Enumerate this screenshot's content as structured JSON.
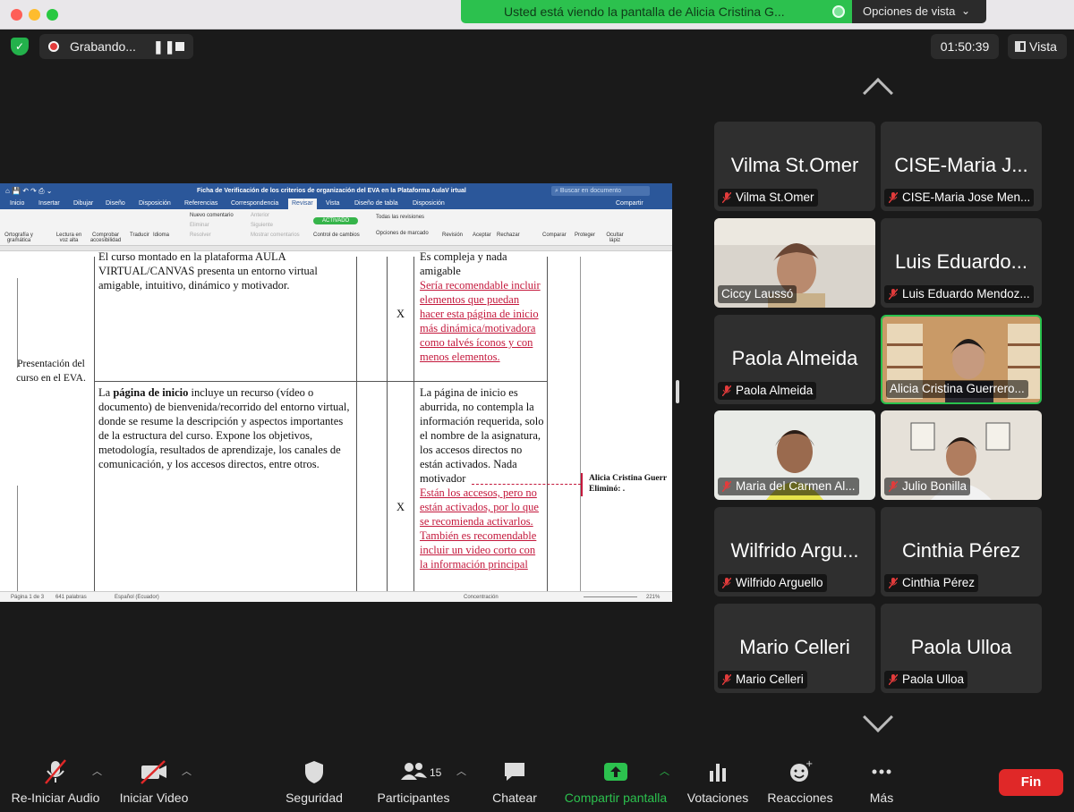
{
  "share_banner": {
    "text": "Usted está viendo la pantalla de Alicia Cristina G...",
    "view_options": "Opciones de vista"
  },
  "top": {
    "recording": "Grabando...",
    "timer": "01:50:39",
    "view": "Vista"
  },
  "word": {
    "title": "Ficha de Verificación de los criterios de organización del EVA en la Plataforma AulaV irtual",
    "search_placeholder": "Buscar en documento",
    "share": "Compartir",
    "tabs": [
      "Inicio",
      "Insertar",
      "Dibujar",
      "Diseño",
      "Disposición",
      "Referencias",
      "Correspondencia",
      "Revisar",
      "Vista",
      "Diseño de tabla",
      "Disposición"
    ],
    "ribbon": [
      "Ortografía y gramática",
      "Lectura en voz alta",
      "Comprobar accesibilidad",
      "Traducir",
      "Idioma",
      "Nuevo comentario",
      "Eliminar",
      "Resolver",
      "Anterior",
      "Siguiente",
      "Mostrar comentarios",
      "ACTIVADO",
      "Control de cambios",
      "Todas las revisiones",
      "Opciones de marcado",
      "Revisión",
      "Aceptar",
      "Rechazar",
      "Comparar",
      "Proteger",
      "Ocultar lápiz"
    ],
    "cells": {
      "row1_text": "El curso montado en la plataforma AULA VIRTUAL/CANVAS presenta un entorno virtual amigable, intuitivo, dinámico y motivador.",
      "row1_mark": "X",
      "row1_obs": "Es compleja y nada amigable",
      "row1_rec": "Sería recomendable incluir elementos que puedan hacer esta página de inicio más dinámica/motivadora como talvés íconos y con menos elementos.",
      "criterion": "Presentación del curso en el EVA.",
      "row2_prefix": "La",
      "row2_bold": "página de inicio",
      "row2_text": "incluye un recurso (vídeo o documento) de bienvenida/recorrido del entorno virtual, donde se resume la descripción y aspectos importantes de la estructura del curso. Expone los objetivos, metodología, resultados de aprendizaje, los canales de comunicación, y los accesos directos, entre otros.",
      "row2_mark": "X",
      "row2_obs": "La página de inicio es aburrida, no contempla la información requerida, solo el nombre de la asignatura, los accesos directos no están activados. Nada motivador",
      "row2_rec": "Están los accesos, pero no están activados, por lo que se recomienda activarlos. También es recomendable incluir un video corto con la información principal",
      "comment_author": "Alicia Cristina Guerr",
      "comment_text": "Eliminó: ."
    },
    "status": {
      "page": "Página 1 de 3",
      "words": "641 palabras",
      "lang": "Español (Ecuador)",
      "focus": "Concentración",
      "zoom": "221%"
    }
  },
  "participants": [
    {
      "big": "Vilma St.Omer",
      "label": "Vilma St.Omer",
      "muted": true
    },
    {
      "big": "CISE-Maria J...",
      "label": "CISE-Maria Jose Men...",
      "muted": true
    },
    {
      "big": "",
      "label": "Ciccy Laussó",
      "muted": false,
      "video": true
    },
    {
      "big": "Luis Eduardo...",
      "label": "Luis Eduardo Mendoz...",
      "muted": true
    },
    {
      "big": "Paola Almeida",
      "label": "Paola Almeida",
      "muted": true
    },
    {
      "big": "",
      "label": "Alicia Cristina Guerrero...",
      "muted": false,
      "video": true,
      "active": true
    },
    {
      "big": "",
      "label": "Maria del Carmen Al...",
      "muted": true,
      "video": true
    },
    {
      "big": "",
      "label": "Julio Bonilla",
      "muted": true,
      "video": true
    },
    {
      "big": "Wilfrido Argu...",
      "label": "Wilfrido Arguello",
      "muted": true
    },
    {
      "big": "Cinthia Pérez",
      "label": "Cinthia Pérez",
      "muted": true
    },
    {
      "big": "Mario Celleri",
      "label": "Mario Celleri",
      "muted": true
    },
    {
      "big": "Paola Ulloa",
      "label": "Paola Ulloa",
      "muted": true
    }
  ],
  "toolbar": {
    "audio": "Re-Iniciar Audio",
    "video": "Iniciar Video",
    "security": "Seguridad",
    "participants": "Participantes",
    "participants_count": "15",
    "chat": "Chatear",
    "share": "Compartir pantalla",
    "polls": "Votaciones",
    "reactions": "Reacciones",
    "more": "Más",
    "end": "Fin"
  }
}
